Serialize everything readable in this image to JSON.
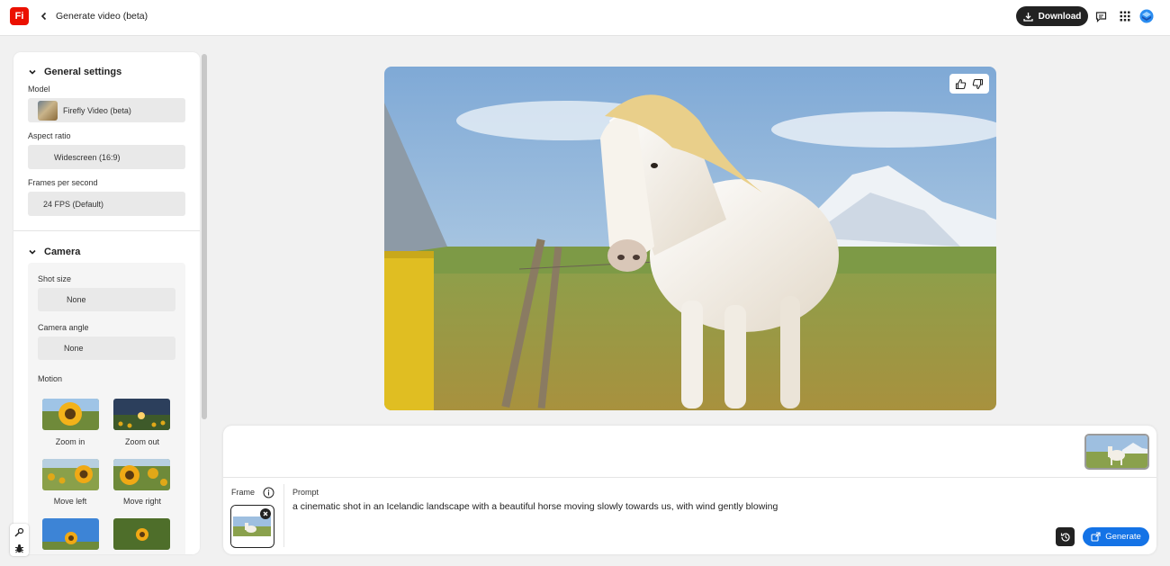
{
  "app": {
    "logo_text": "Fi",
    "title": "Generate video (beta)"
  },
  "header": {
    "download_label": "Download"
  },
  "sidebar": {
    "general": {
      "title": "General settings",
      "model_label": "Model",
      "model_value": "Firefly Video (beta)",
      "aspect_label": "Aspect ratio",
      "aspect_value": "Widescreen (16:9)",
      "fps_label": "Frames per second",
      "fps_value": "24 FPS (Default)"
    },
    "camera": {
      "title": "Camera",
      "shot_label": "Shot size",
      "shot_value": "None",
      "angle_label": "Camera angle",
      "angle_value": "None",
      "motion_label": "Motion",
      "motions": [
        "Zoom in",
        "Zoom out",
        "Move left",
        "Move right"
      ]
    }
  },
  "prompt": {
    "frame_label": "Frame",
    "prompt_label": "Prompt",
    "text": "a cinematic shot in an Icelandic landscape with a beautiful horse moving slowly towards us, with wind gently blowing",
    "generate_label": "Generate"
  },
  "colors": {
    "brand": "#eb1000",
    "accent": "#1473e6",
    "dark": "#222222"
  }
}
